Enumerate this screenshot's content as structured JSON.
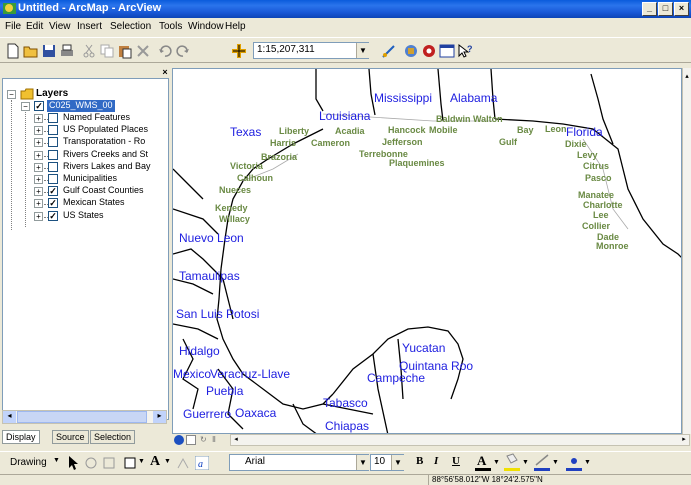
{
  "window": {
    "title": "Untitled - ArcMap - ArcView",
    "buttons": [
      "_",
      "□",
      "×"
    ]
  },
  "menu": [
    "File",
    "Edit",
    "View",
    "Insert",
    "Selection",
    "Tools",
    "Window",
    "Help"
  ],
  "toolbar": {
    "scale": "1:15,207,311",
    "icons": [
      "new-icon",
      "open-icon",
      "save-icon",
      "print-icon",
      "cut-icon",
      "copy-icon",
      "paste-icon",
      "delete-icon",
      "undo-icon",
      "redo-icon",
      "add-data-icon",
      "editor-icon",
      "arctoolbox-icon",
      "python-icon",
      "command-line-icon",
      "whats-this-icon"
    ]
  },
  "toc": {
    "root": "Layers",
    "group": "C025_WMS_00",
    "layers": [
      {
        "name": "Named Features",
        "checked": false
      },
      {
        "name": "US Populated Places",
        "checked": false
      },
      {
        "name": "Transporatation - Ro",
        "checked": false
      },
      {
        "name": "Rivers Creeks and St",
        "checked": false
      },
      {
        "name": "Rivers Lakes and Bay",
        "checked": false
      },
      {
        "name": "Municipalities",
        "checked": false
      },
      {
        "name": "Gulf Coast Counties",
        "checked": true
      },
      {
        "name": "Mexican States",
        "checked": true
      },
      {
        "name": "US States",
        "checked": true
      }
    ],
    "tabs": [
      "Display",
      "Source",
      "Selection"
    ]
  },
  "map": {
    "state_labels": [
      {
        "text": "Mississippi"
      },
      {
        "text": "Alabama"
      },
      {
        "text": "Louisiana"
      },
      {
        "text": "Texas"
      },
      {
        "text": "Florida"
      },
      {
        "text": "Nuevo Leon"
      },
      {
        "text": "Tamaulipas"
      },
      {
        "text": "San Luis Potosi"
      },
      {
        "text": "Hidalgo"
      },
      {
        "text": "Mexico"
      },
      {
        "text": "Veracruz-Llave"
      },
      {
        "text": "Puebla"
      },
      {
        "text": "Guerrero"
      },
      {
        "text": "Oaxaca"
      },
      {
        "text": "Tabasco"
      },
      {
        "text": "Chiapas"
      },
      {
        "text": "Yucatan"
      },
      {
        "text": "Quintana Roo"
      },
      {
        "text": "Campeche"
      }
    ],
    "county_labels": [
      "Baldwin",
      "Walton",
      "Hancock",
      "Mobile",
      "Liberty",
      "Acadia",
      "Bay",
      "Leon",
      "Harris",
      "Cameron",
      "Jefferson",
      "Gulf",
      "Dixie",
      "Terrebonne",
      "Plaquemines",
      "Brazoria",
      "Levy",
      "Victoria",
      "Citrus",
      "Calhoun",
      "Pasco",
      "Nueces",
      "Manatee",
      "Charlotte",
      "Kenedy",
      "Lee",
      "Willacy",
      "Collier",
      "Dade",
      "Monroe"
    ]
  },
  "drawbar": {
    "drawing_label": "Drawing",
    "font": "Arial",
    "size": "10",
    "styles": [
      "B",
      "I",
      "U"
    ]
  },
  "status": {
    "coords": "88°56'58.012\"W  18°24'2.575\"N"
  }
}
